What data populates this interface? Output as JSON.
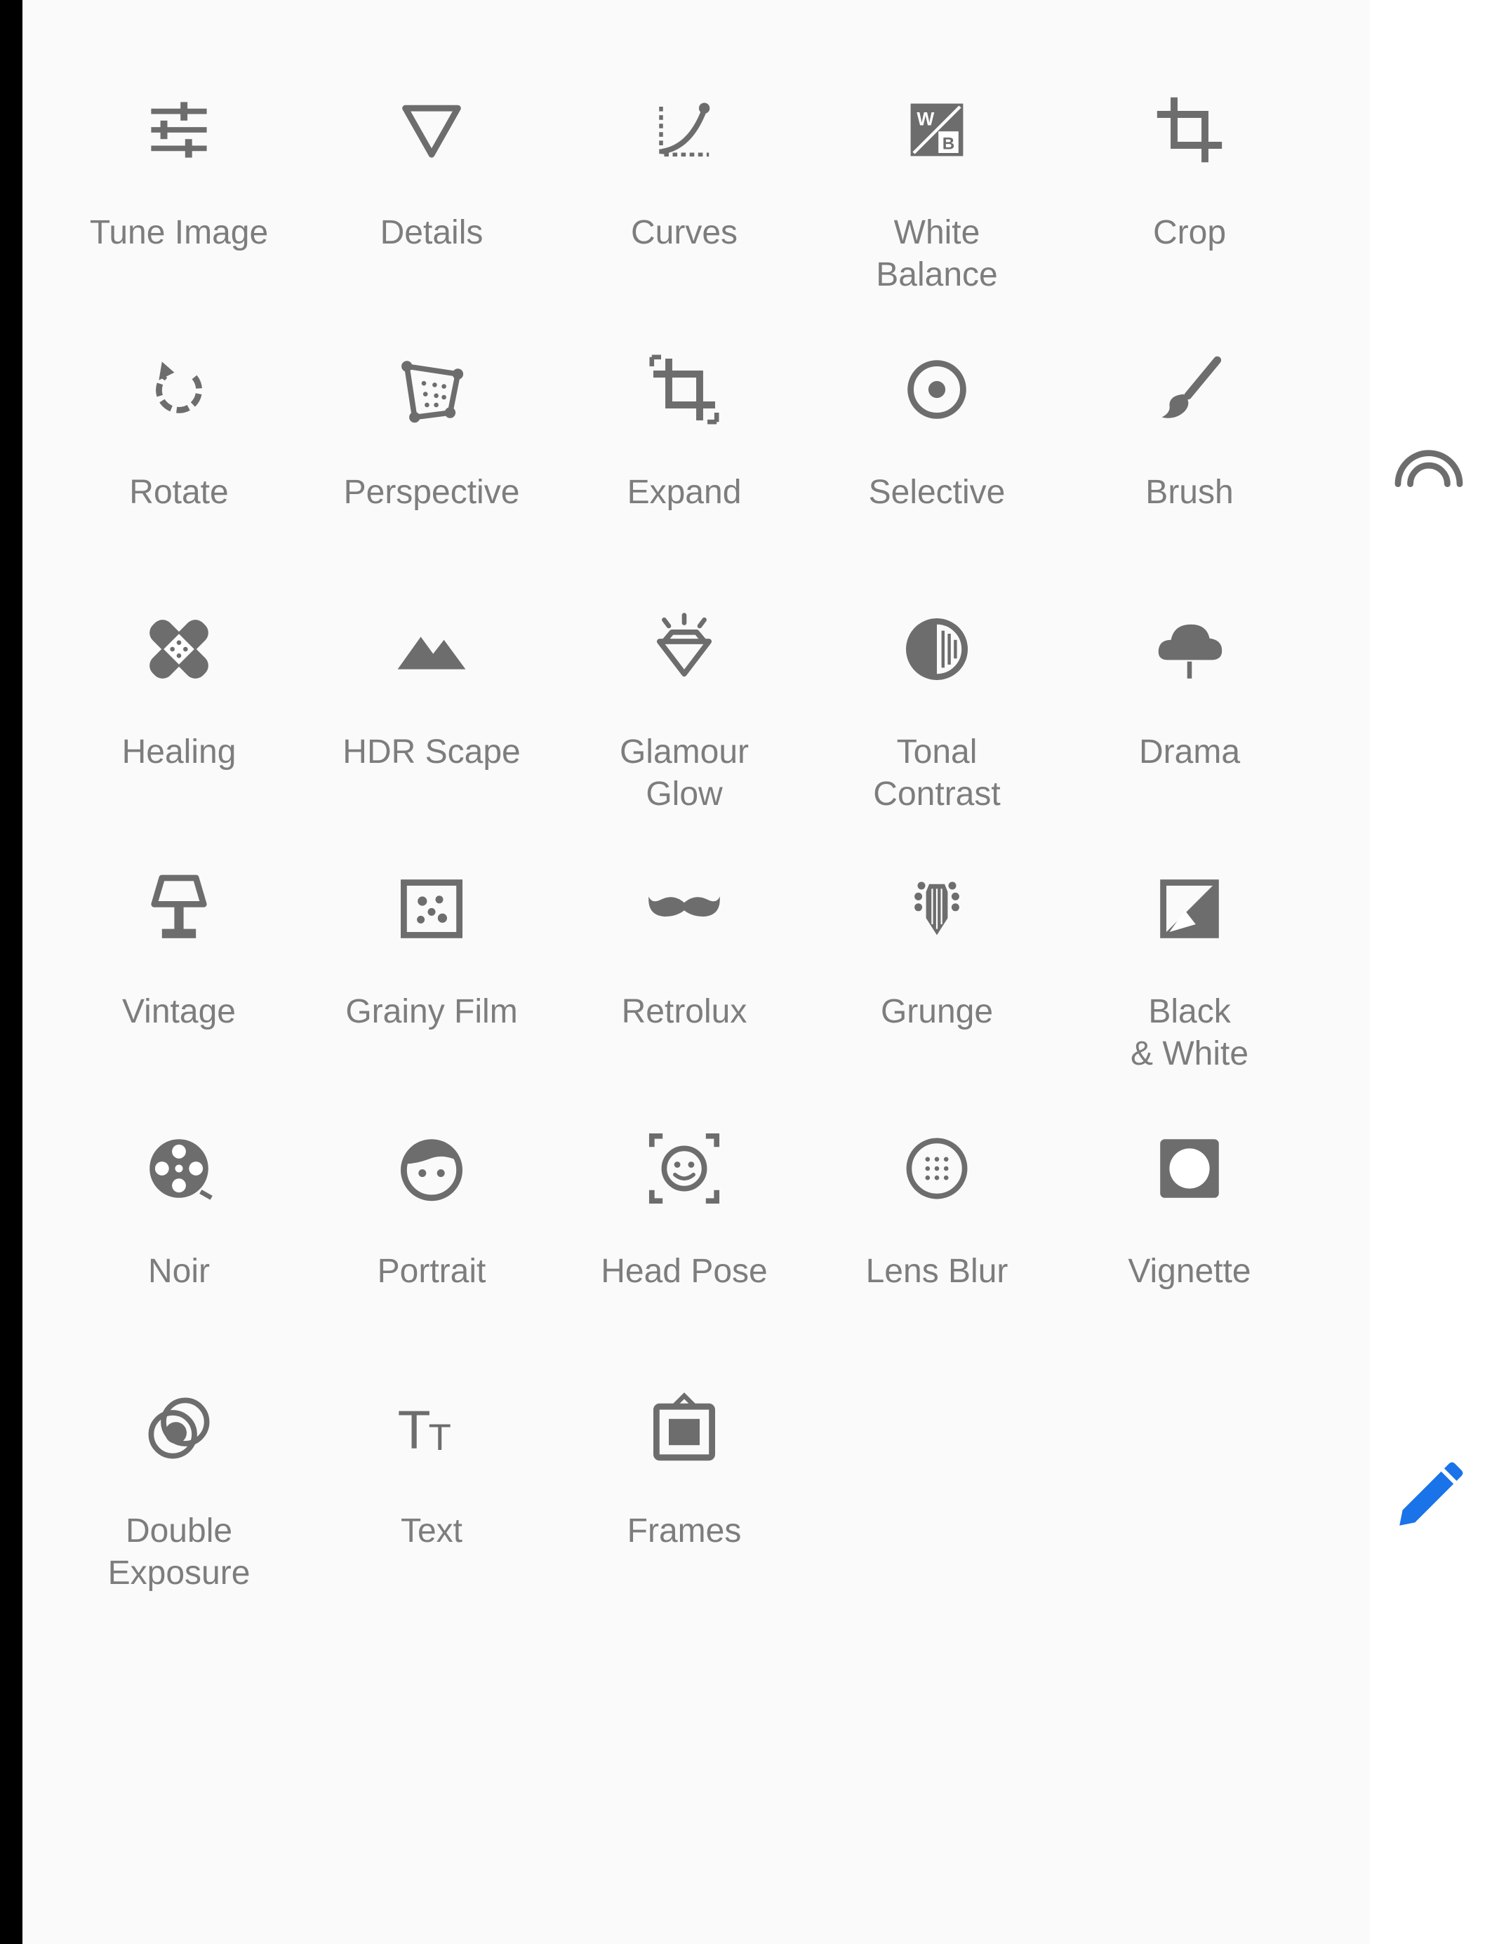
{
  "tools": [
    {
      "label": "Tune Image",
      "icon": "tune-icon"
    },
    {
      "label": "Details",
      "icon": "triangle-icon"
    },
    {
      "label": "Curves",
      "icon": "curves-icon"
    },
    {
      "label": "White\nBalance",
      "icon": "white-balance-icon"
    },
    {
      "label": "Crop",
      "icon": "crop-icon"
    },
    {
      "label": "Rotate",
      "icon": "rotate-icon"
    },
    {
      "label": "Perspective",
      "icon": "perspective-icon"
    },
    {
      "label": "Expand",
      "icon": "expand-icon"
    },
    {
      "label": "Selective",
      "icon": "target-icon"
    },
    {
      "label": "Brush",
      "icon": "brush-icon"
    },
    {
      "label": "Healing",
      "icon": "bandage-icon"
    },
    {
      "label": "HDR Scape",
      "icon": "mountains-icon"
    },
    {
      "label": "Glamour\nGlow",
      "icon": "diamond-icon"
    },
    {
      "label": "Tonal\nContrast",
      "icon": "half-circle-icon"
    },
    {
      "label": "Drama",
      "icon": "cloud-icon"
    },
    {
      "label": "Vintage",
      "icon": "lamp-icon"
    },
    {
      "label": "Grainy Film",
      "icon": "film-grain-icon"
    },
    {
      "label": "Retrolux",
      "icon": "mustache-icon"
    },
    {
      "label": "Grunge",
      "icon": "guitar-icon"
    },
    {
      "label": "Black\n& White",
      "icon": "black-white-icon"
    },
    {
      "label": "Noir",
      "icon": "film-reel-icon"
    },
    {
      "label": "Portrait",
      "icon": "face-icon"
    },
    {
      "label": "Head Pose",
      "icon": "head-pose-icon"
    },
    {
      "label": "Lens Blur",
      "icon": "lens-blur-icon"
    },
    {
      "label": "Vignette",
      "icon": "vignette-icon"
    },
    {
      "label": "Double\nExposure",
      "icon": "double-exposure-icon"
    },
    {
      "label": "Text",
      "icon": "text-icon"
    },
    {
      "label": "Frames",
      "icon": "frame-icon"
    }
  ],
  "rail": {
    "styles_icon": "rainbow-arch-icon",
    "edit_icon": "pencil-icon"
  },
  "colors": {
    "icon": "#6d6d6d",
    "label": "#7d7d7d",
    "accent": "#1a73e8"
  }
}
